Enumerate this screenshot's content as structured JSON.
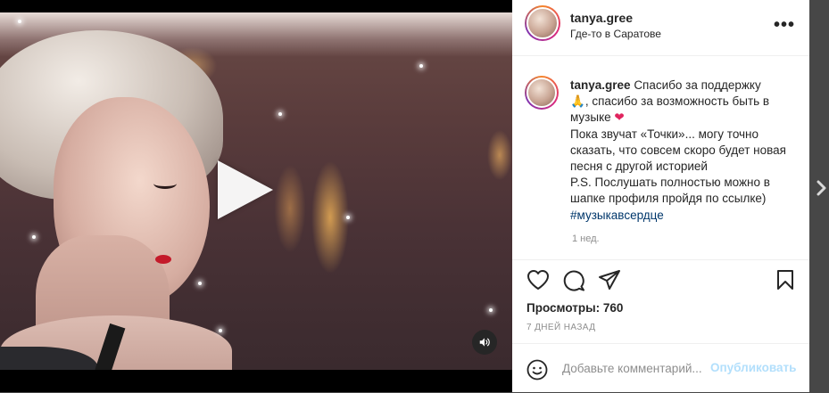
{
  "post": {
    "username": "tanya.gree",
    "location": "Где-то в Саратове",
    "more_label": "•••"
  },
  "caption": {
    "username": "tanya.gree",
    "line1": "Спасибо за поддержку",
    "line2_emoji": "🙏",
    "line2": ", спасибо за возможность быть в музыке",
    "heart": "❤",
    "line3": "Пока звучат «Точки»... могу точно сказать, что совсем скоро будет новая песня с другой историей",
    "line4": "P.S. Послушать полностью можно в шапке профиля пройдя по ссылке)",
    "hashtag": "#музыкавсердце",
    "time": "1 нед."
  },
  "stats": {
    "views": "Просмотры: 760",
    "date": "7 ДНЕЙ НАЗАД"
  },
  "comment": {
    "placeholder": "Добавьте комментарий...",
    "publish_label": "Опубликовать"
  },
  "icons": {
    "like": "heart-icon",
    "comment": "comment-icon",
    "share": "share-icon",
    "save": "bookmark-icon",
    "emoji": "emoji-icon",
    "play": "play-icon",
    "sound": "speaker-icon",
    "next": "chevron-right-icon"
  },
  "colors": {
    "hashtag": "#00376b",
    "publish_disabled": "#b2dffc",
    "secondary_text": "#8e8e8e",
    "heart": "#e0245e"
  }
}
